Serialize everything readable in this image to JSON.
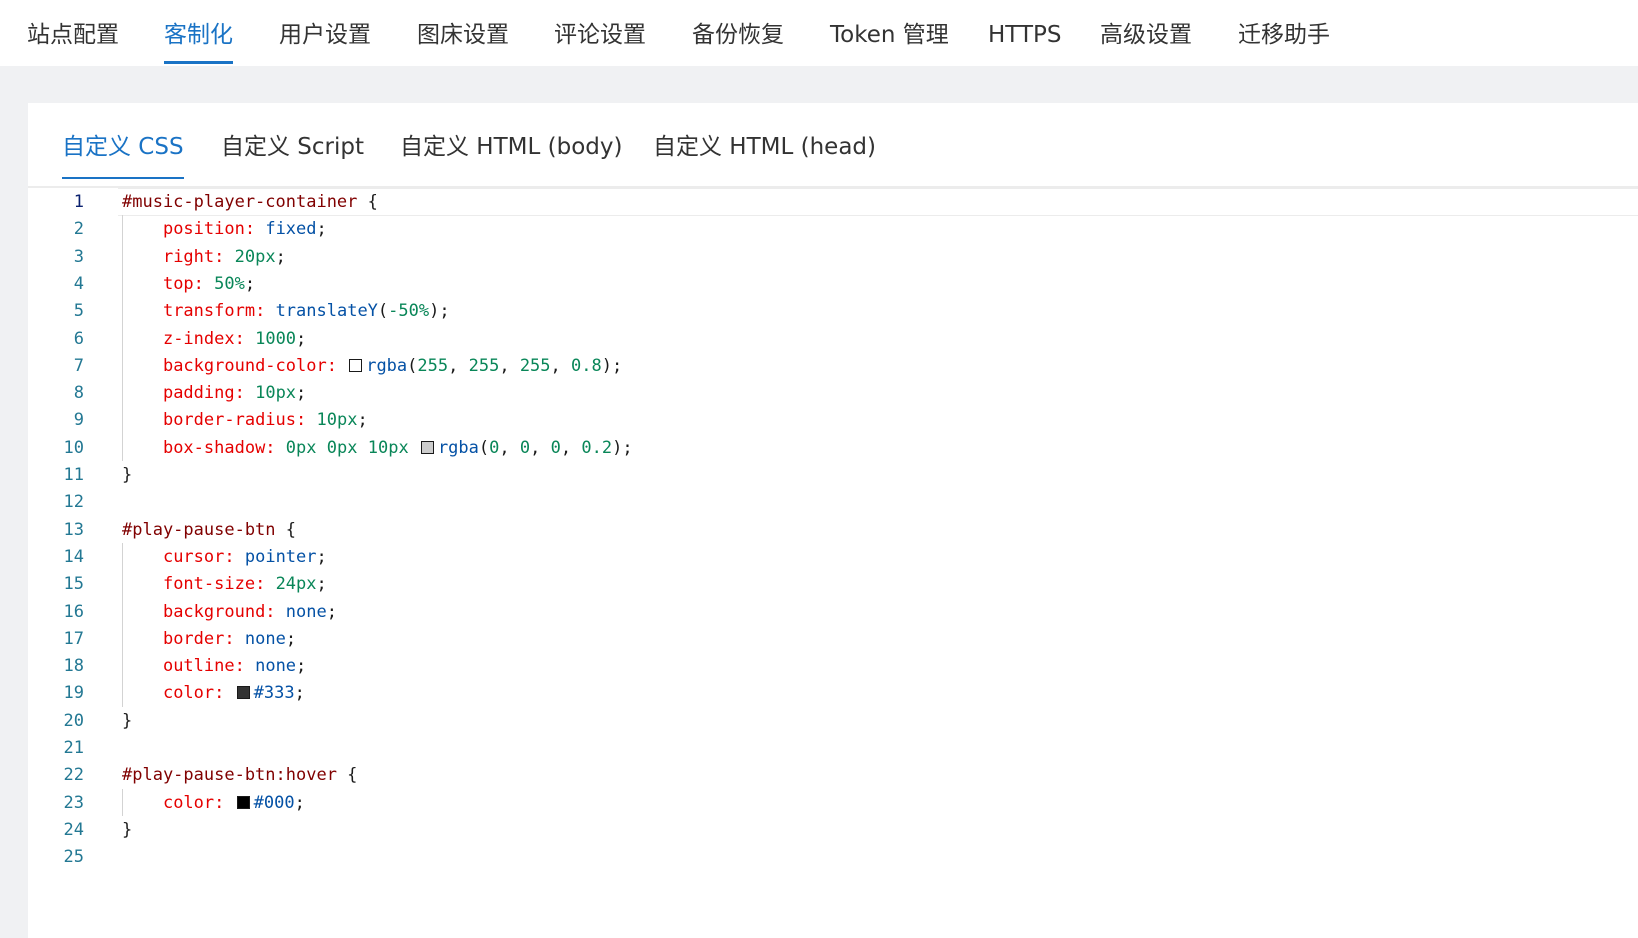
{
  "top_tabs": [
    {
      "label": "站点配置",
      "active": false
    },
    {
      "label": "客制化",
      "active": true
    },
    {
      "label": "用户设置",
      "active": false
    },
    {
      "label": "图床设置",
      "active": false
    },
    {
      "label": "评论设置",
      "active": false
    },
    {
      "label": "备份恢复",
      "active": false
    },
    {
      "label": "Token 管理",
      "active": false
    },
    {
      "label": "HTTPS",
      "active": false
    },
    {
      "label": "高级设置",
      "active": false
    },
    {
      "label": "迁移助手",
      "active": false
    }
  ],
  "sub_tabs": [
    {
      "label": "自定义 CSS",
      "active": true
    },
    {
      "label": "自定义 Script",
      "active": false
    },
    {
      "label": "自定义 HTML (body)",
      "active": false
    },
    {
      "label": "自定义 HTML (head)",
      "active": false
    }
  ],
  "editor": {
    "language": "css",
    "current_line": 1,
    "lines": [
      "#music-player-container {",
      "    position: fixed;",
      "    right: 20px;",
      "    top: 50%;",
      "    transform: translateY(-50%);",
      "    z-index: 1000;",
      "    background-color: rgba(255, 255, 255, 0.8);",
      "    padding: 10px;",
      "    border-radius: 10px;",
      "    box-shadow: 0px 0px 10px rgba(0, 0, 0, 0.2);",
      "}",
      "",
      "#play-pause-btn {",
      "    cursor: pointer;",
      "    font-size: 24px;",
      "    background: none;",
      "    border: none;",
      "    outline: none;",
      "    color: #333;",
      "}",
      "",
      "#play-pause-btn:hover {",
      "    color: #000;",
      "}",
      ""
    ]
  },
  "colors": {
    "accent": "#1a73c5",
    "selector": "#800000",
    "property": "#e50000",
    "value": "#0451a5",
    "number": "#098658",
    "line_number": "#237893"
  }
}
